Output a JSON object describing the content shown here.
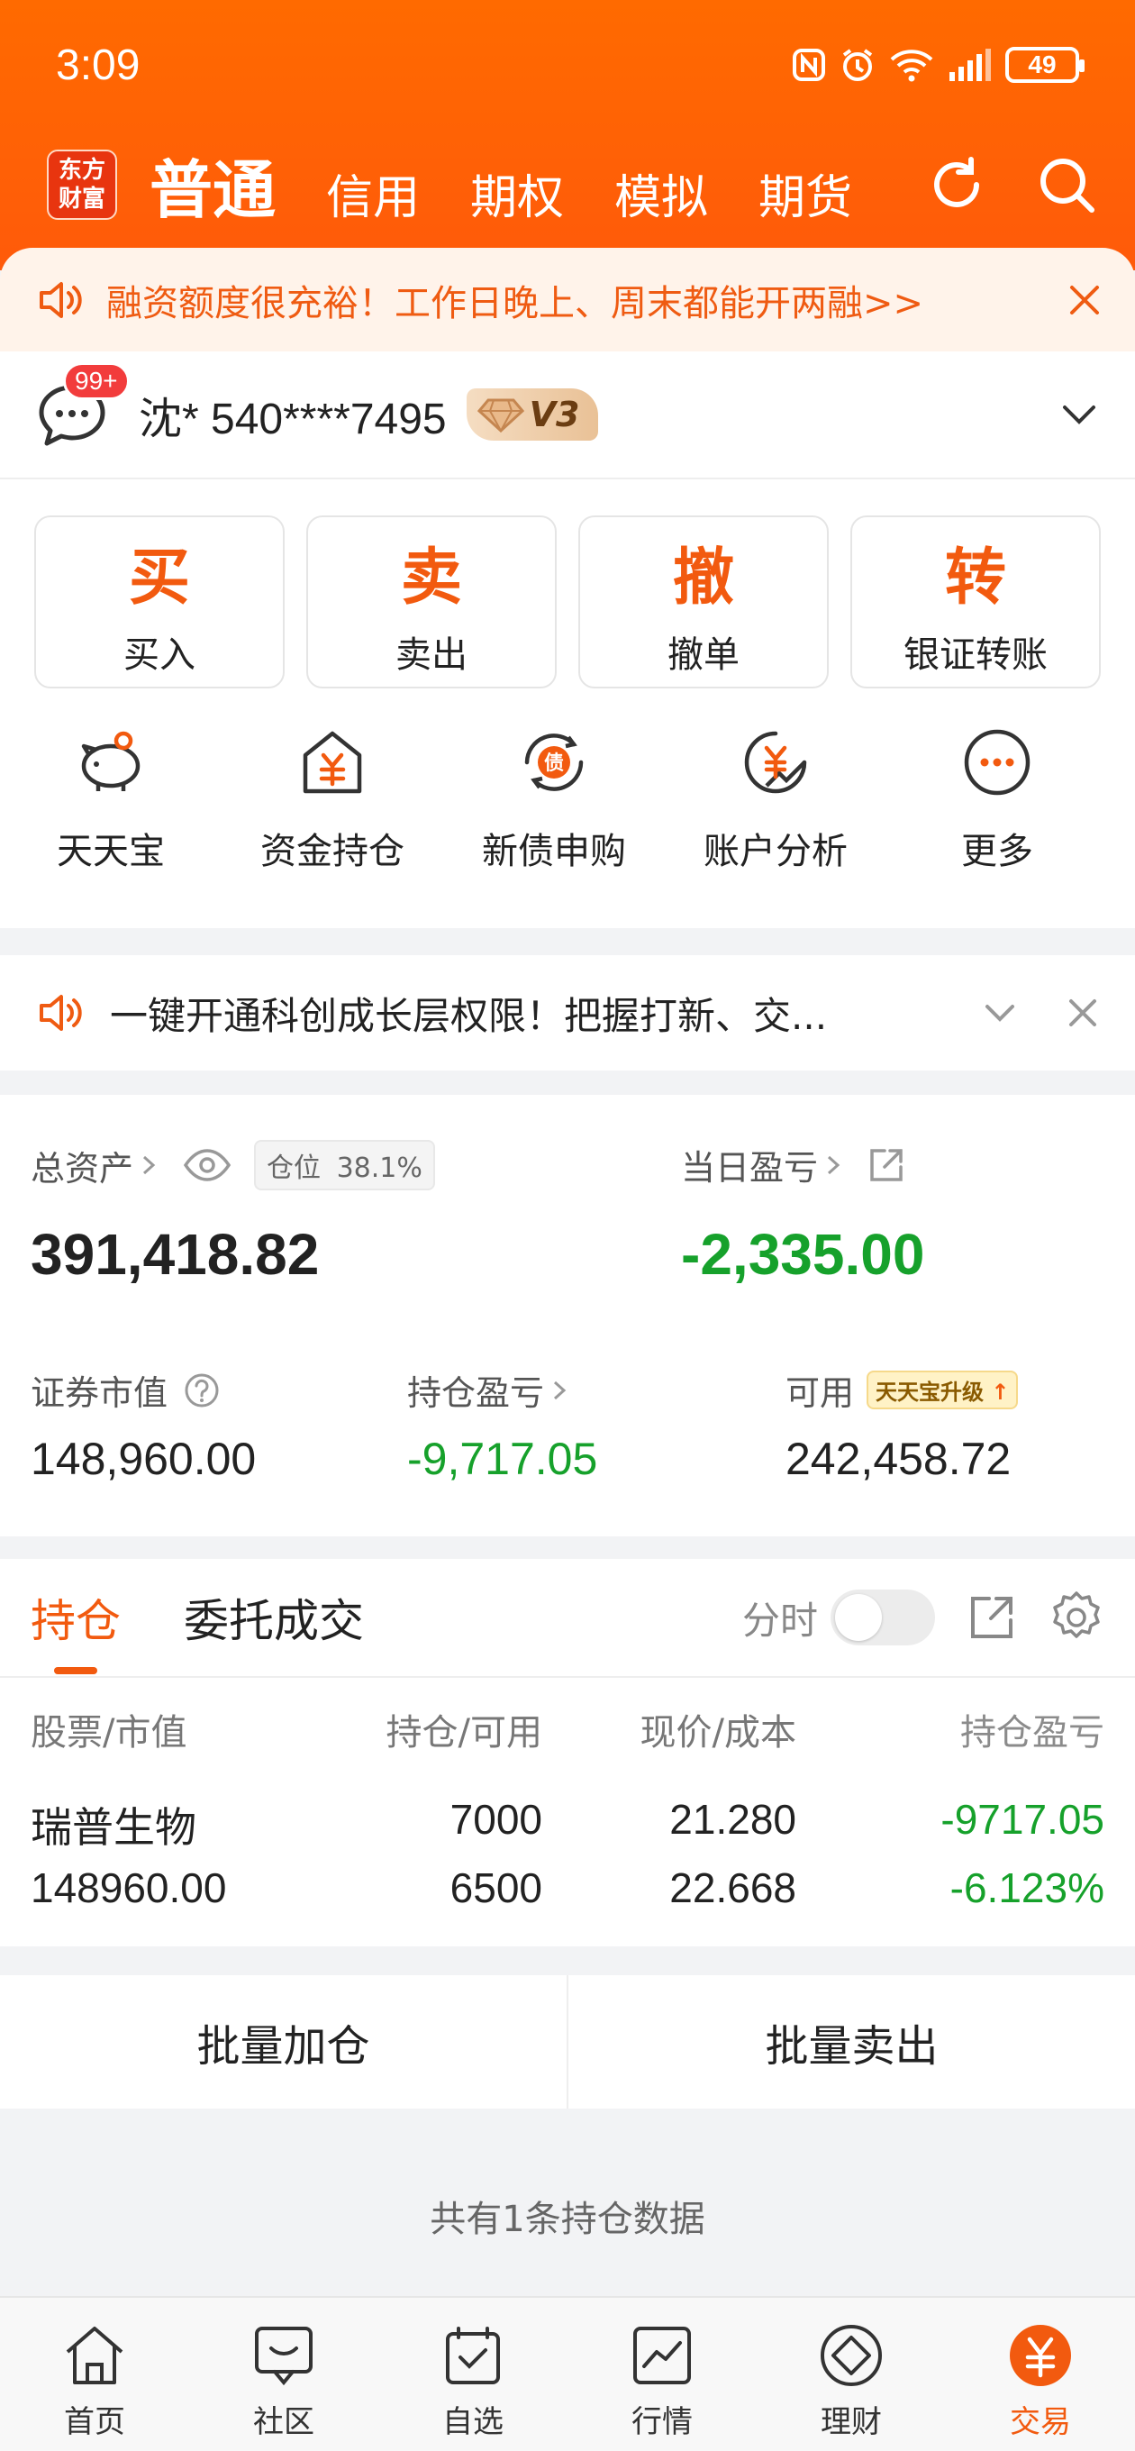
{
  "status": {
    "time": "3:09",
    "battery": "49"
  },
  "nav": {
    "logo": "东方\n财富",
    "active": "普通",
    "tabs": [
      "信用",
      "期权",
      "模拟",
      "期货"
    ]
  },
  "promo": {
    "text": "融资额度很充裕！工作日晚上、周末都能开两融>>"
  },
  "account": {
    "badge": "99+",
    "name": "沈* 540****7495",
    "level": "V3"
  },
  "trade_buttons": [
    {
      "glyph": "买",
      "label": "买入"
    },
    {
      "glyph": "卖",
      "label": "卖出"
    },
    {
      "glyph": "撤",
      "label": "撤单"
    },
    {
      "glyph": "转",
      "label": "银证转账"
    }
  ],
  "shortcuts": [
    {
      "label": "天天宝",
      "icon": "piggy-bank-icon"
    },
    {
      "label": "资金持仓",
      "icon": "yuan-house-icon"
    },
    {
      "label": "新债申购",
      "icon": "bond-icon"
    },
    {
      "label": "账户分析",
      "icon": "analysis-icon"
    },
    {
      "label": "更多",
      "icon": "more-icon"
    }
  ],
  "notice": {
    "text": "一键开通科创成长层权限！把握打新、交..."
  },
  "assets": {
    "total_label": "总资产",
    "position_label": "仓位",
    "position_value": "38.1%",
    "total_value": "391,418.82",
    "daily_label": "当日盈亏",
    "daily_value": "-2,335.00",
    "market_label": "证券市值",
    "market_value": "148,960.00",
    "hold_pl_label": "持仓盈亏",
    "hold_pl_value": "-9,717.05",
    "avail_label": "可用",
    "upgrade_label": "天天宝升级",
    "avail_value": "242,458.72"
  },
  "holdings": {
    "tab_active": "持仓",
    "tab_other": "委托成交",
    "fenshi": "分时",
    "headers": [
      "股票/市值",
      "持仓/可用",
      "现价/成本",
      "持仓盈亏"
    ],
    "rows": [
      {
        "name": "瑞普生物",
        "market_value": "148960.00",
        "hold": "7000",
        "avail": "6500",
        "price": "21.280",
        "cost": "22.668",
        "pl": "-9717.05",
        "pl_pct": "-6.123%"
      }
    ]
  },
  "batch": {
    "add": "批量加仓",
    "sell": "批量卖出"
  },
  "count_text": "共有1条持仓数据",
  "tabbar": [
    {
      "label": "首页",
      "icon": "home-icon"
    },
    {
      "label": "社区",
      "icon": "community-icon"
    },
    {
      "label": "自选",
      "icon": "watchlist-icon"
    },
    {
      "label": "行情",
      "icon": "market-icon"
    },
    {
      "label": "理财",
      "icon": "wealth-icon"
    },
    {
      "label": "交易",
      "icon": "trade-icon"
    }
  ],
  "colors": {
    "brand": "#f25a0f",
    "loss": "#16a12b"
  }
}
